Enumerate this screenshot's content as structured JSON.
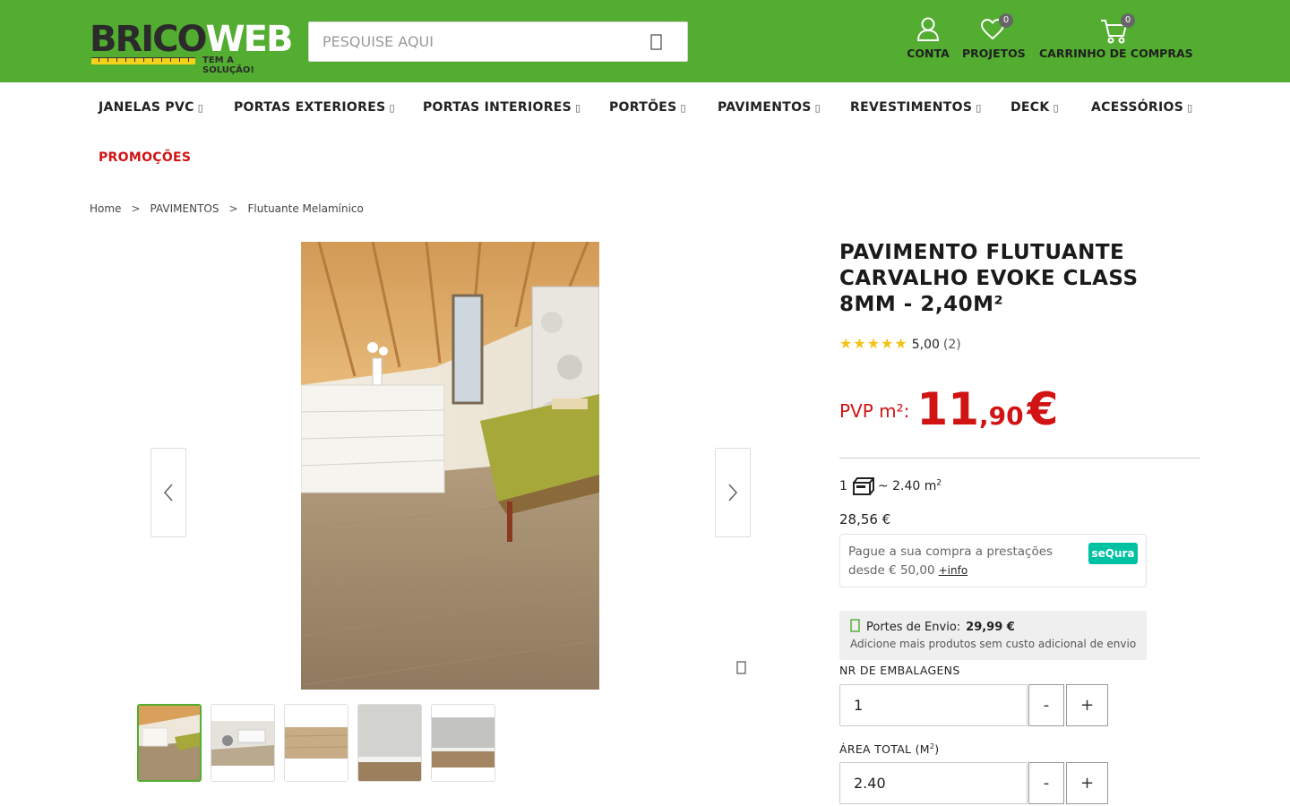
{
  "header": {
    "logo_part1": "BRICO",
    "logo_part2": "WEB",
    "logo_tagline": "TEM A SOLUÇÃO!",
    "search_placeholder": "PESQUISE AQUI",
    "account_label": "CONTA",
    "projects_label": "PROJETOS",
    "projects_count": "0",
    "cart_label": "CARRINHO DE COMPRAS",
    "cart_count": "0",
    "brand_color": "#52ad30"
  },
  "menu": {
    "items": [
      {
        "label": "JANELAS PVC",
        "icon": "chevron-down-icon"
      },
      {
        "label": "PORTAS EXTERIORES",
        "icon": "chevron-down-icon"
      },
      {
        "label": "PORTAS INTERIORES",
        "icon": "chevron-down-icon"
      },
      {
        "label": "PORTÕES",
        "icon": "chevron-down-icon"
      },
      {
        "label": "PAVIMENTOS",
        "icon": "chevron-down-icon"
      },
      {
        "label": "REVESTIMENTOS",
        "icon": "chevron-down-icon"
      },
      {
        "label": "DECK",
        "icon": "chevron-down-icon"
      },
      {
        "label": "ACESSÓRIOS",
        "icon": "chevron-down-icon"
      }
    ],
    "promo_label": "PROMOÇÕES",
    "promo_color": "#d11313"
  },
  "breadcrumb": {
    "items": [
      "Home",
      "PAVIMENTOS",
      "Flutuante Melamínico"
    ],
    "separator": ">"
  },
  "product": {
    "title": "PAVIMENTO FLUTUANTE CARVALHO EVOKE CLASS 8MM - 2,40M²",
    "stars": "★★★★★",
    "rating": "5,00",
    "rating_count": "(2)",
    "price_prefix": "PVP m²:",
    "price_int": "11",
    "price_dec": ",90",
    "price_currency": "€",
    "pack_qty": "1",
    "pack_area_prefix": "~ 2.40 m",
    "pack_area_sup": "2",
    "pack_price": "28,56 €",
    "sequra_text": "Pague a sua compra a prestações desde € 50,00",
    "sequra_info": "+info",
    "sequra_logo": "seQura",
    "shipping_label": "Portes de Envio:",
    "shipping_price": "29,99 €",
    "shipping_note": "Adicione mais produtos sem custo adicional de envio",
    "packages_label": "NR DE EMBALAGENS",
    "packages_value": "1",
    "area_label_prefix": "ÁREA TOTAL (M",
    "area_label_sup": "2",
    "area_label_suffix": ")",
    "area_value": "2.40",
    "minus": "-",
    "plus": "+"
  },
  "gallery": {
    "thumb_count": 5,
    "active_thumb": 1
  }
}
